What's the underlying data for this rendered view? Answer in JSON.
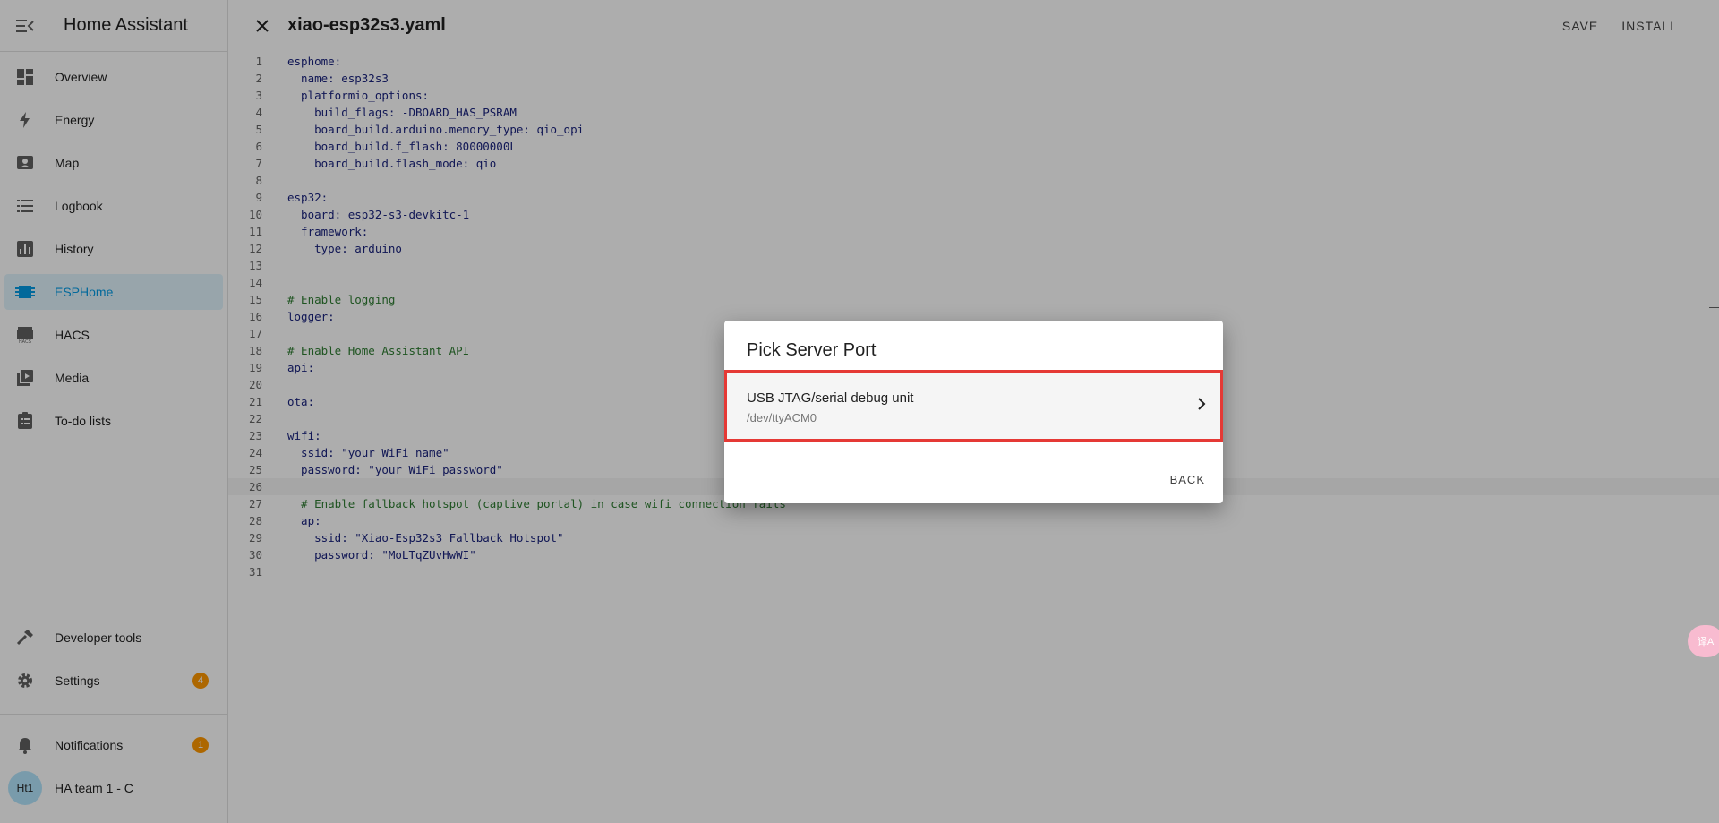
{
  "sidebar": {
    "title": "Home Assistant",
    "items": [
      {
        "label": "Overview",
        "icon": "dashboard-icon"
      },
      {
        "label": "Energy",
        "icon": "lightning-icon"
      },
      {
        "label": "Map",
        "icon": "map-icon"
      },
      {
        "label": "Logbook",
        "icon": "list-icon"
      },
      {
        "label": "History",
        "icon": "chart-icon"
      },
      {
        "label": "ESPHome",
        "icon": "chip-icon",
        "active": true
      },
      {
        "label": "HACS",
        "icon": "hacs-icon"
      },
      {
        "label": "Media",
        "icon": "media-icon"
      },
      {
        "label": "To-do lists",
        "icon": "clipboard-icon"
      }
    ],
    "bottom": {
      "developer_tools": "Developer tools",
      "settings": "Settings",
      "settings_badge": "4",
      "notifications": "Notifications",
      "notifications_badge": "1",
      "user_initials": "Ht1",
      "user_name": "HA team 1 - C"
    }
  },
  "editor": {
    "file_title": "xiao-esp32s3.yaml",
    "save_label": "SAVE",
    "install_label": "INSTALL",
    "lines": [
      "esphome:",
      "  name: esp32s3",
      "  platformio_options:",
      "    build_flags: -DBOARD_HAS_PSRAM",
      "    board_build.arduino.memory_type: qio_opi",
      "    board_build.f_flash: 80000000L",
      "    board_build.flash_mode: qio",
      "",
      "esp32:",
      "  board: esp32-s3-devkitc-1",
      "  framework:",
      "    type: arduino",
      "",
      "",
      "# Enable logging",
      "logger:",
      "",
      "# Enable Home Assistant API",
      "api:",
      "",
      "ota:",
      "",
      "wifi:",
      "  ssid: \"your WiFi name\"",
      "  password: \"your WiFi password\"",
      "",
      "  # Enable fallback hotspot (captive portal) in case wifi connection fails",
      "  ap:",
      "    ssid: \"Xiao-Esp32s3 Fallback Hotspot\"",
      "    password: \"MoLTqZUvHwWI\"",
      ""
    ]
  },
  "dialog": {
    "title": "Pick Server Port",
    "port_name": "USB JTAG/serial debug unit",
    "port_path": "/dev/ttyACM0",
    "back_label": "BACK"
  },
  "translate_fab": "译A"
}
